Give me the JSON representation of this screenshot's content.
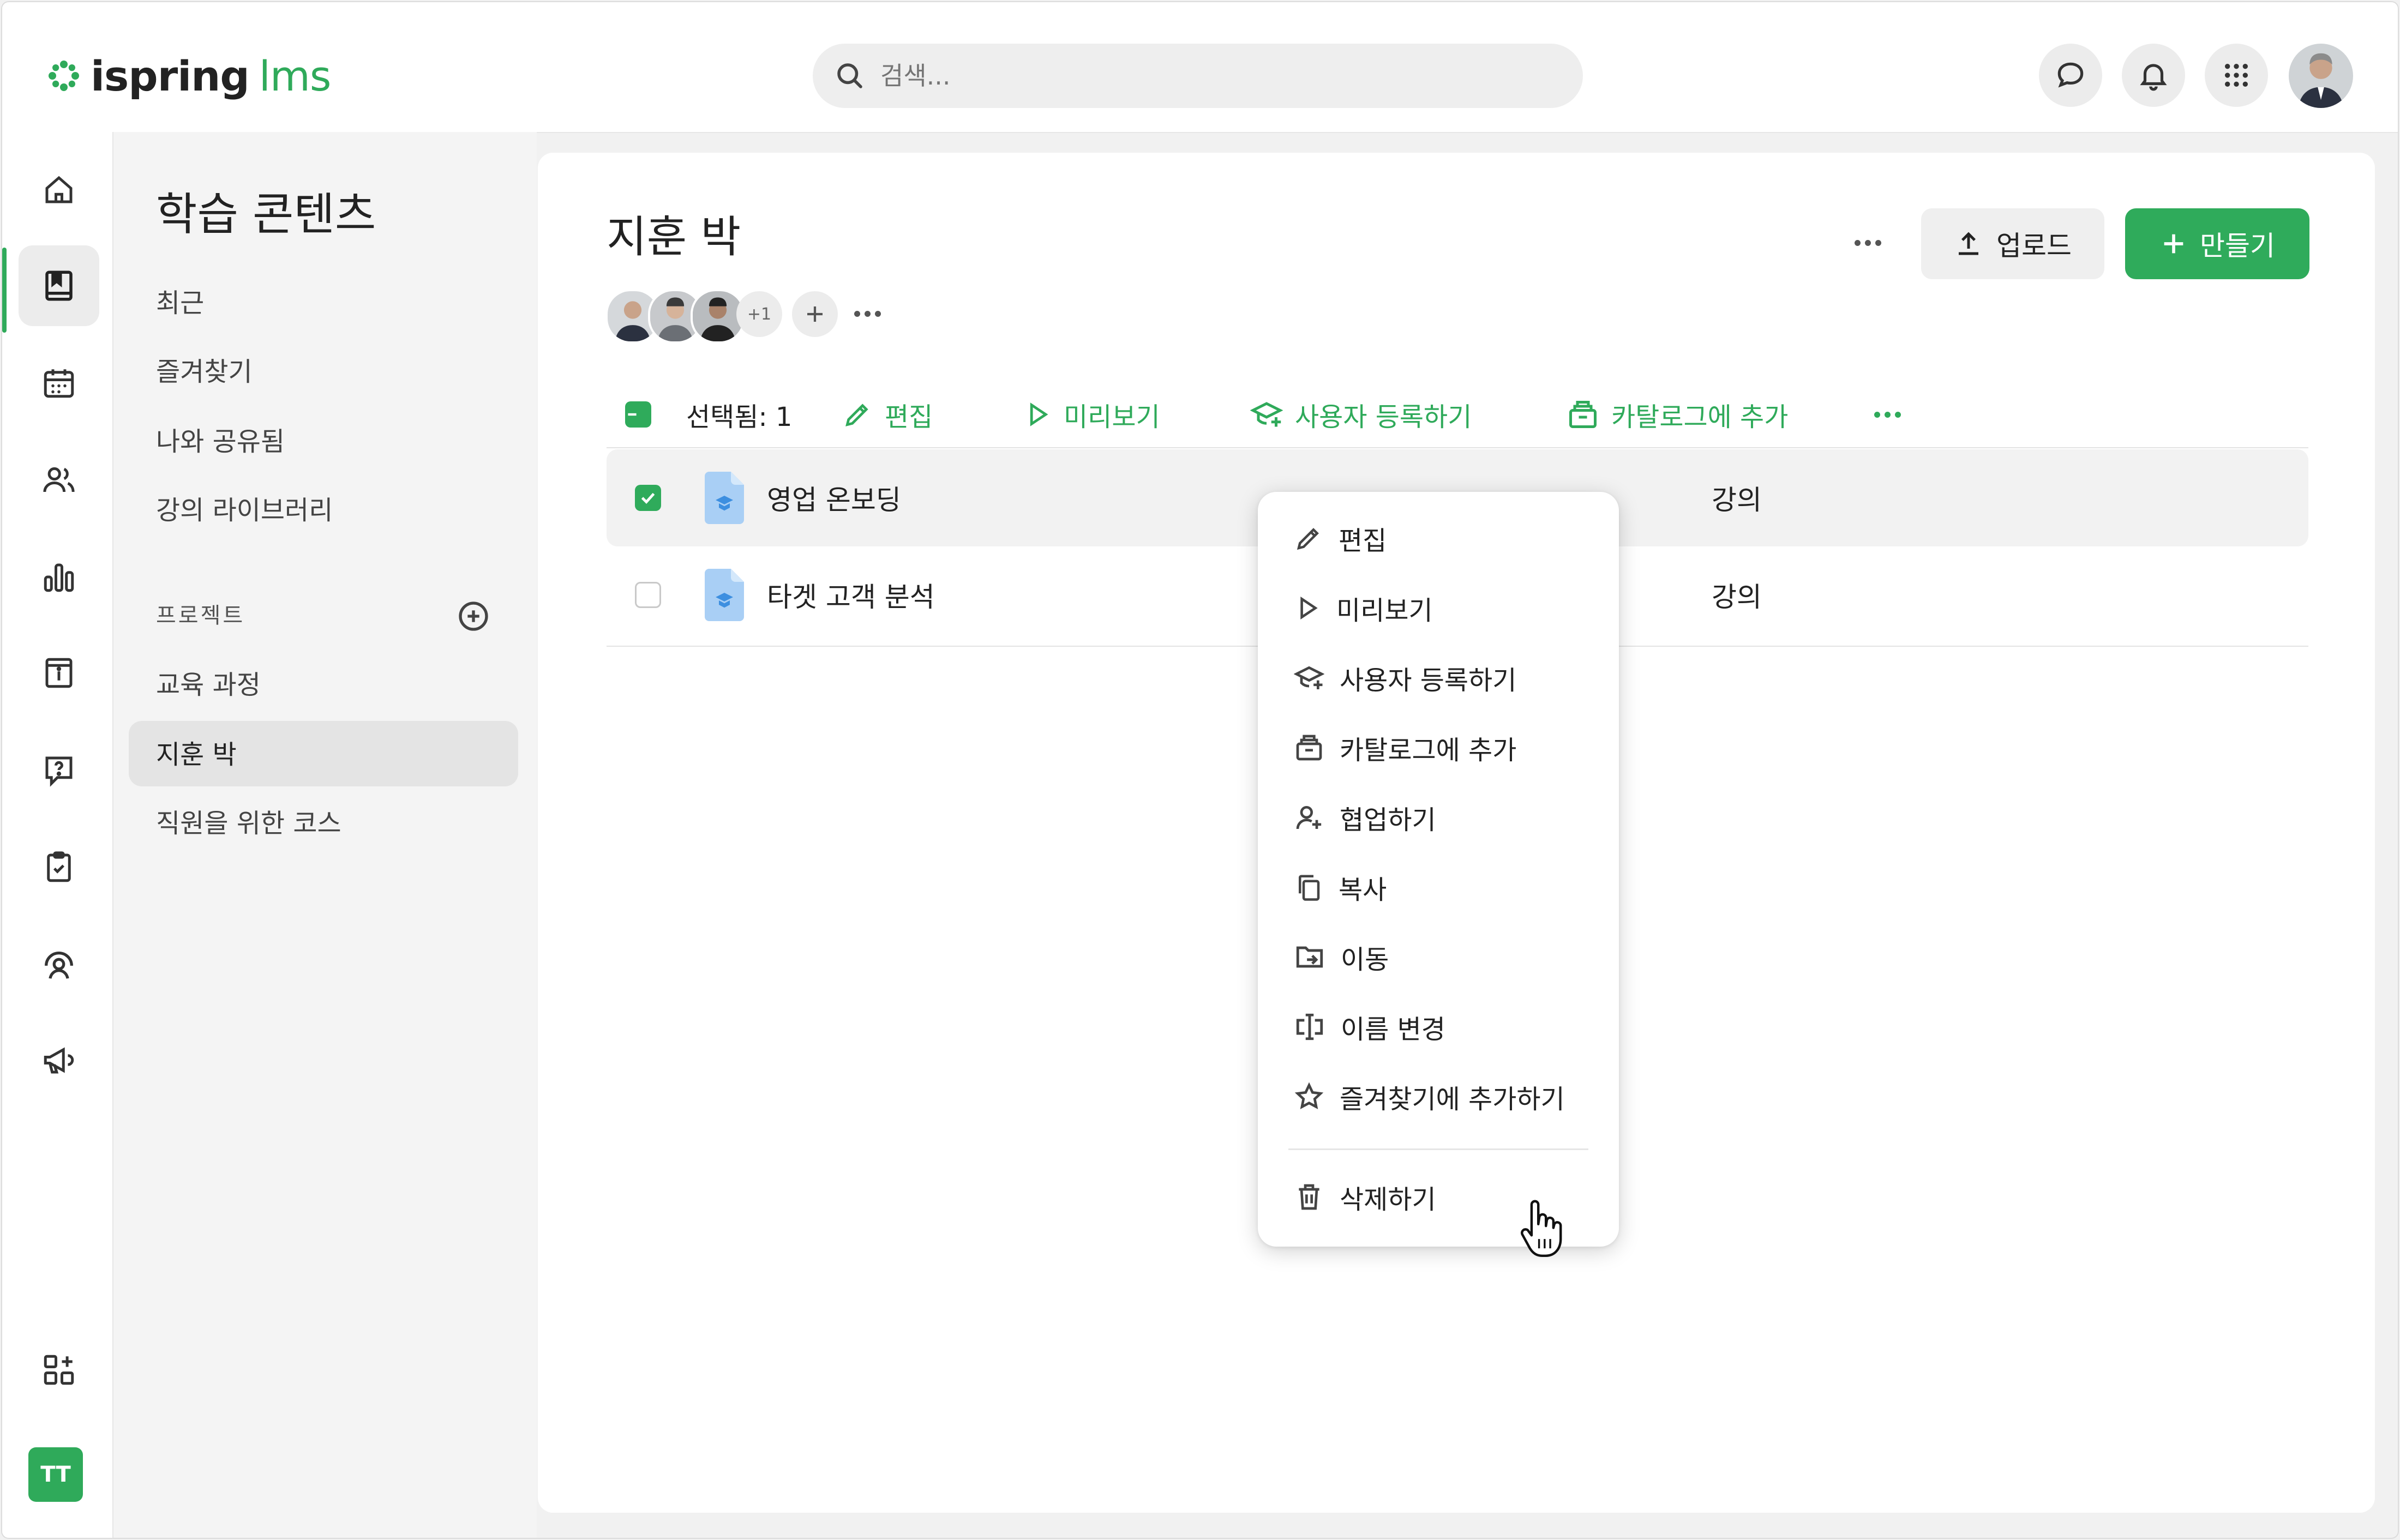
{
  "app": {
    "logo_text_1": "ispring",
    "logo_text_2": "lms",
    "brand_color": "#2faa5a"
  },
  "search": {
    "placeholder": "검색..."
  },
  "sidebar": {
    "title": "학습 콘텐츠",
    "items": [
      {
        "label": "최근"
      },
      {
        "label": "즐겨찾기"
      },
      {
        "label": "나와 공유됨"
      },
      {
        "label": "강의 라이브러리"
      }
    ],
    "projects_header": "프로젝트",
    "projects": [
      {
        "label": "교육 과정"
      },
      {
        "label": "지훈 박",
        "active": true
      },
      {
        "label": "직원을 위한 코스"
      }
    ]
  },
  "rail": {
    "icons": [
      "home-icon",
      "book-icon",
      "calendar-icon",
      "users-icon",
      "chart-icon",
      "info-icon",
      "question-icon",
      "clipboard-check-icon",
      "support-icon",
      "megaphone-icon",
      "apps-add-icon"
    ],
    "user_initials": "TT"
  },
  "page": {
    "title": "지훈 박",
    "avatars_more": "+1",
    "upload_label": "업로드",
    "create_label": "만들기"
  },
  "toolbar": {
    "selected": "선택됨: 1",
    "edit": "편집",
    "preview": "미리보기",
    "enroll": "사용자 등록하기",
    "catalog": "카탈로그에 추가"
  },
  "table": {
    "rows": [
      {
        "name": "영업 온보딩",
        "type": "강의",
        "checked": true
      },
      {
        "name": "타겟 고객 분석",
        "type": "강의",
        "checked": false
      }
    ]
  },
  "context_menu": {
    "items": [
      {
        "label": "편집",
        "icon": "pencil-icon"
      },
      {
        "label": "미리보기",
        "icon": "play-icon"
      },
      {
        "label": "사용자 등록하기",
        "icon": "graduation-icon"
      },
      {
        "label": "카탈로그에 추가",
        "icon": "catalog-icon"
      },
      {
        "label": "협업하기",
        "icon": "user-add-icon"
      },
      {
        "label": "복사",
        "icon": "copy-icon"
      },
      {
        "label": "이동",
        "icon": "move-folder-icon"
      },
      {
        "label": "이름 변경",
        "icon": "rename-icon"
      },
      {
        "label": "즐겨찾기에 추가하기",
        "icon": "star-icon"
      }
    ],
    "delete": {
      "label": "삭제하기",
      "icon": "trash-icon"
    }
  }
}
